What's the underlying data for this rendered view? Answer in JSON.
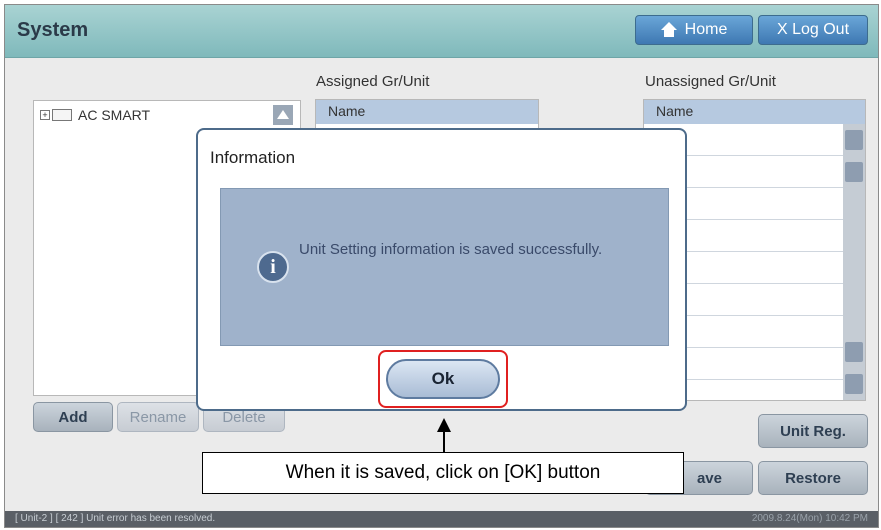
{
  "header": {
    "title": "System",
    "home_label": "Home",
    "logout_label": "X Log Out"
  },
  "assigned": {
    "title": "Assigned Gr/Unit",
    "column": "Name"
  },
  "unassigned": {
    "title": "Unassigned Gr/Unit",
    "column": "Name"
  },
  "tree": {
    "root_label": "AC SMART"
  },
  "buttons": {
    "add": "Add",
    "rename": "Rename",
    "delete": "Delete",
    "unit_reg": "Unit Reg.",
    "save_partial": "ave",
    "restore": "Restore"
  },
  "dialog": {
    "title": "Information",
    "message": "Unit Setting information is saved successfully.",
    "ok_label": "Ok"
  },
  "callout": {
    "text": "When it is saved, click on [OK] button"
  },
  "status": {
    "message": "[ Unit-2 ] [ 242 ] Unit error has been resolved.",
    "datetime": "2009.8.24(Mon)  10:42 PM"
  },
  "icons": {
    "home": "home-icon",
    "info": "info-icon"
  },
  "colors": {
    "header": "#7fb9bb",
    "accent_button": "#3e78b2",
    "highlight": "#e02020"
  }
}
